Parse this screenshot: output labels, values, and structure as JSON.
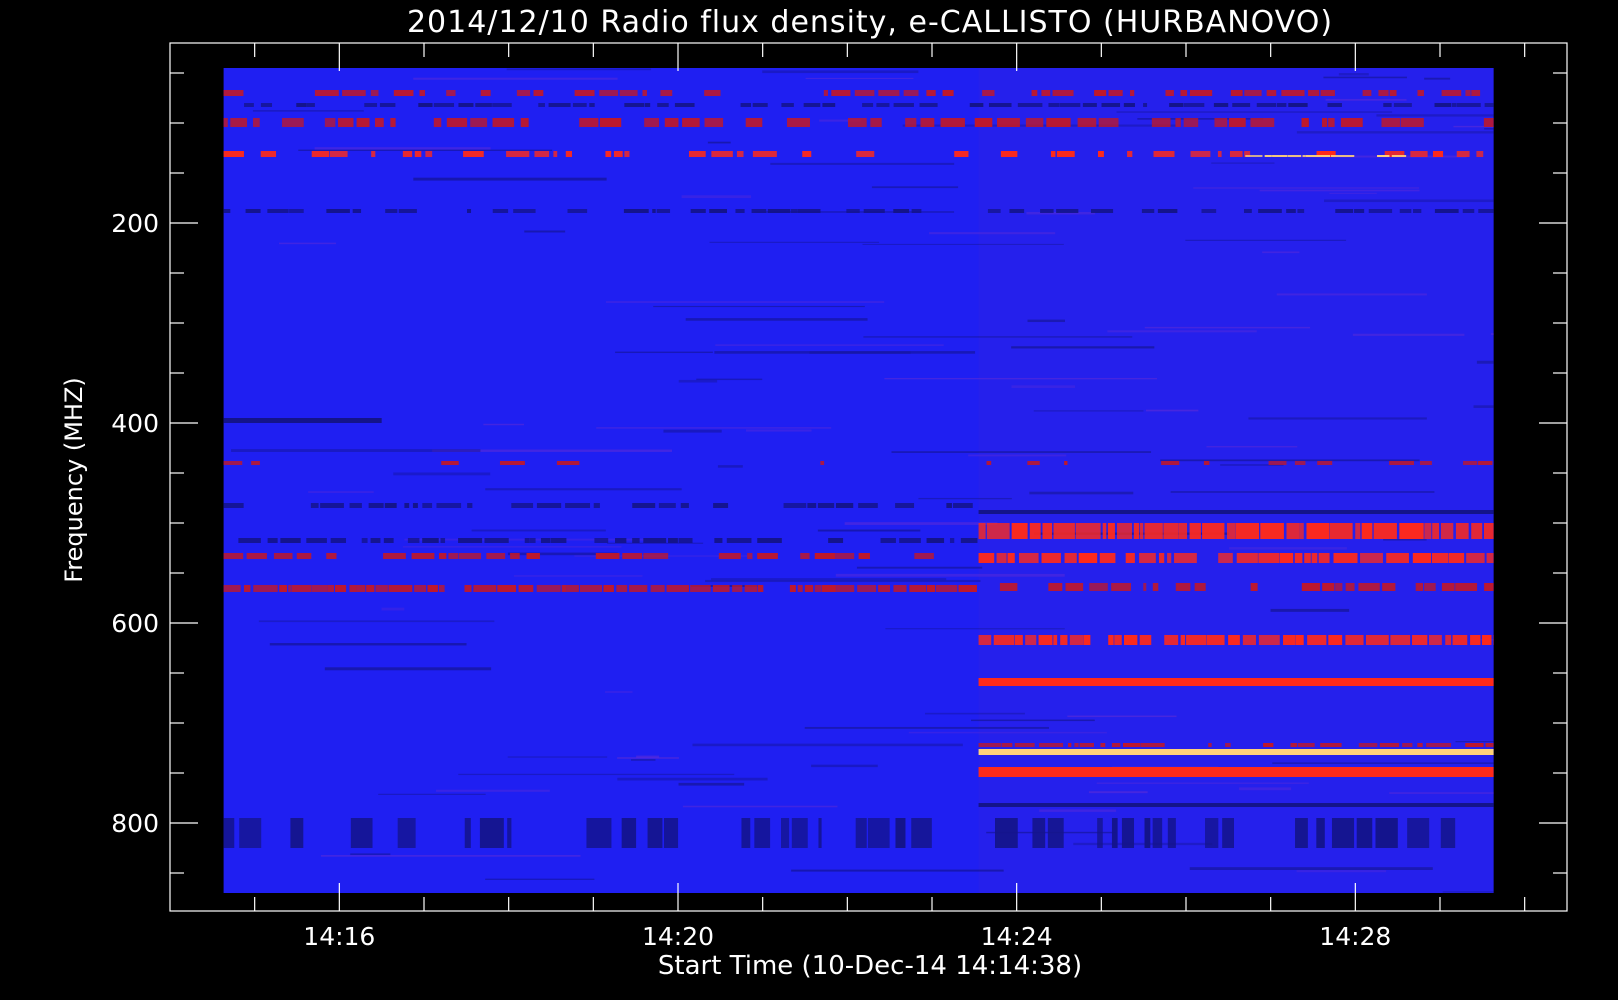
{
  "chart_data": {
    "type": "heatmap",
    "title": "2014/12/10  Radio flux density, e-CALLISTO (HURBANOVO)",
    "xlabel": "Start Time (10-Dec-14 14:14:38)",
    "ylabel": "Frequency (MHZ)",
    "x_ticks": [
      "14:16",
      "14:20",
      "14:24",
      "14:28"
    ],
    "y_ticks": [
      "200",
      "400",
      "600",
      "800"
    ],
    "x_range_minutes": [
      14.0,
      30.5
    ],
    "data_x_range_minutes": [
      14.633,
      29.633
    ],
    "y_range_mhz": [
      20,
      888
    ],
    "data_y_range_mhz": [
      45,
      870
    ],
    "inverted_y": true,
    "grid": false,
    "regime_change_minutes": 23.55,
    "colors": {
      "background": "#000000",
      "base": "#1f1ff2",
      "low": "#14148a",
      "mid": "#c0182a",
      "high": "#ff2a1a",
      "peak": "#ffd27a"
    },
    "bands": [
      {
        "f1": 67,
        "f2": 73,
        "from": 14.633,
        "to": 29.633,
        "level": "mid",
        "density": 0.55
      },
      {
        "f1": 80,
        "f2": 84,
        "from": 14.633,
        "to": 29.633,
        "level": "low",
        "density": 0.6
      },
      {
        "f1": 95,
        "f2": 104,
        "from": 14.633,
        "to": 29.633,
        "level": "mid",
        "density": 0.6
      },
      {
        "f1": 128,
        "f2": 134,
        "from": 14.633,
        "to": 29.633,
        "level": "high",
        "density": 0.45
      },
      {
        "f1": 132,
        "f2": 134,
        "from": 26.7,
        "to": 28.6,
        "level": "peak",
        "density": 0.8
      },
      {
        "f1": 186,
        "f2": 190,
        "from": 14.633,
        "to": 29.633,
        "level": "low",
        "density": 0.5
      },
      {
        "f1": 395,
        "f2": 400,
        "from": 14.633,
        "to": 16.5,
        "level": "low",
        "density": 1.0
      },
      {
        "f1": 438,
        "f2": 442,
        "from": 14.633,
        "to": 29.633,
        "level": "mid",
        "density": 0.3
      },
      {
        "f1": 480,
        "f2": 485,
        "from": 14.633,
        "to": 23.55,
        "level": "low",
        "density": 0.5
      },
      {
        "f1": 515,
        "f2": 520,
        "from": 14.633,
        "to": 23.55,
        "level": "low",
        "density": 0.6
      },
      {
        "f1": 530,
        "f2": 536,
        "from": 14.633,
        "to": 23.55,
        "level": "mid",
        "density": 0.55
      },
      {
        "f1": 562,
        "f2": 569,
        "from": 14.633,
        "to": 23.55,
        "level": "mid",
        "density": 0.8
      },
      {
        "f1": 487,
        "f2": 491,
        "from": 23.55,
        "to": 29.633,
        "level": "low",
        "density": 1.0
      },
      {
        "f1": 500,
        "f2": 516,
        "from": 23.55,
        "to": 29.633,
        "level": "high",
        "density": 0.85
      },
      {
        "f1": 530,
        "f2": 540,
        "from": 23.55,
        "to": 29.633,
        "level": "high",
        "density": 0.75
      },
      {
        "f1": 560,
        "f2": 568,
        "from": 23.55,
        "to": 29.633,
        "level": "mid",
        "density": 0.6
      },
      {
        "f1": 612,
        "f2": 622,
        "from": 23.55,
        "to": 29.633,
        "level": "high",
        "density": 0.8
      },
      {
        "f1": 655,
        "f2": 663,
        "from": 23.55,
        "to": 29.633,
        "level": "high",
        "density": 1.0
      },
      {
        "f1": 720,
        "f2": 724,
        "from": 23.55,
        "to": 29.633,
        "level": "mid",
        "density": 0.6
      },
      {
        "f1": 726,
        "f2": 732,
        "from": 23.55,
        "to": 29.633,
        "level": "peak",
        "density": 1.0
      },
      {
        "f1": 744,
        "f2": 754,
        "from": 23.55,
        "to": 29.633,
        "level": "high",
        "density": 0.95
      },
      {
        "f1": 780,
        "f2": 784,
        "from": 23.55,
        "to": 29.633,
        "level": "low",
        "density": 1.0
      },
      {
        "f1": 795,
        "f2": 825,
        "from": 14.633,
        "to": 29.633,
        "level": "low",
        "density": 0.35
      }
    ]
  }
}
